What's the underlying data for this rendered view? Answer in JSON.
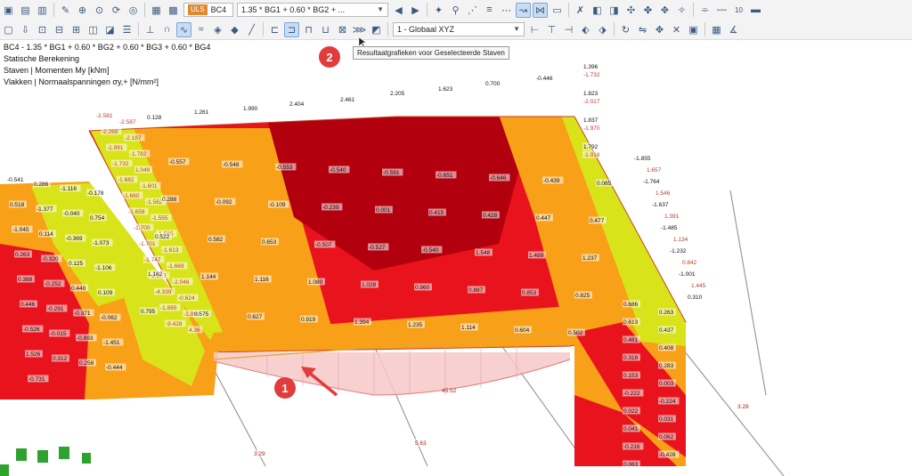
{
  "toolbar": {
    "loadcase_code": "BC4",
    "uls_badge": "ULS",
    "combination_expr": "1.35 * BG1 + 0.60 * BG2 + ...",
    "coordinate_system": "1 - Globaal XYZ",
    "text_icon_label": "10"
  },
  "info": {
    "line1": "BC4 - 1.35 * BG1 + 0.60 * BG2 + 0.60 * BG3 + 0.60 * BG4",
    "line2": "Statische Berekening",
    "line3": "Staven | Momenten My [kNm]",
    "line4": "Vlakken | Normaalspanningen σy,+ [N/mm²]"
  },
  "tooltip": "Resultaatgrafieken voor Geselecteerde Staven",
  "callouts": {
    "one": "1",
    "two": "2"
  },
  "colors": {
    "dark_red": "#b3000e",
    "red": "#e8131c",
    "orange": "#f8a017",
    "yellow": "#d9e31a",
    "pink": "#f6c9c8",
    "callout": "#e23b3b"
  },
  "labels": {
    "top_edge": [
      "0.128",
      "1.261",
      "1.990",
      "2.404",
      "2.461",
      "2.205",
      "1.623",
      "0.700",
      "-0.446"
    ],
    "top_right": [
      "1.396",
      "-1.732",
      "1.823",
      "-2.017",
      "1.837",
      "-1.970",
      "1.792",
      "-1.916"
    ],
    "right_edge": [
      "-1.855",
      "1.657",
      "-1.764",
      "1.546",
      "-1.637",
      "1.391",
      "-1.485",
      "1.134",
      "-1.232",
      "0.842",
      "-1.001",
      "1.445",
      "0.310"
    ],
    "left_top": [
      "-2.581",
      "-2.587",
      "-2.269",
      "-2.187",
      "-1.991",
      "-1.782",
      "-1.732",
      "1.049",
      "-1.682",
      "-1.601",
      "-1.660",
      "-1.562",
      "-1.658",
      "-1.555",
      "-1.700",
      "-1.595",
      "-1.701",
      "-1.613",
      "-1.747",
      "-1.669",
      "-2.107",
      "-2.046",
      "-4.339",
      "-0.624",
      "-1.885",
      "-1.998",
      "-9.428",
      "4.36"
    ],
    "left_field": [
      "-0.541",
      "0.286",
      "-1.116",
      "-0.178",
      "0.518",
      "-1.377",
      "-0.040",
      "0.754",
      "-1.045",
      "0.114",
      "-0.369",
      "-1.073",
      "0.263",
      "-0.320",
      "0.125",
      "-1.106",
      "0.388",
      "-0.252",
      "0.440",
      "0.109",
      "0.446",
      "-0.291",
      "-0.371",
      "-0.062",
      "-0.526",
      "-0.015",
      "-0.893",
      "-1.451",
      "1.526",
      "0.312",
      "0.258",
      "-0.444",
      "-0.731"
    ],
    "surface": [
      "-0.557",
      "-0.548",
      "-0.553",
      "-0.540",
      "-0.591",
      "-0.651",
      "-0.646",
      "-0.439",
      "0.085",
      "0.288",
      "-0.092",
      "-0.109",
      "-0.239",
      "0.001",
      "0.415",
      "0.428",
      "0.447",
      "0.477",
      "0.522",
      "0.582",
      "0.653",
      "-0.507",
      "-0.527",
      "-0.540",
      "1.548",
      "1.489",
      "1.237",
      "1.182",
      "1.144",
      "1.116",
      "1.080",
      "1.028",
      "0.960",
      "0.887",
      "0.853",
      "0.825",
      "0.795",
      "0.575",
      "0.627",
      "0.919",
      "1.394",
      "1.235",
      "1.114",
      "0.604",
      "0.502"
    ],
    "right_column": [
      "0.686",
      "0.263",
      "0.613",
      "0.437",
      "0.481",
      "0.408",
      "0.318",
      "0.283",
      "0.153",
      "0.003",
      "-0.222",
      "-0.224",
      "0.022",
      "0.031",
      "0.041",
      "0.062",
      "-0.216",
      "-0.428",
      "0.063"
    ],
    "diagram_value": "45.52",
    "member_values": [
      "5.63",
      "3.29",
      "3.28"
    ]
  }
}
